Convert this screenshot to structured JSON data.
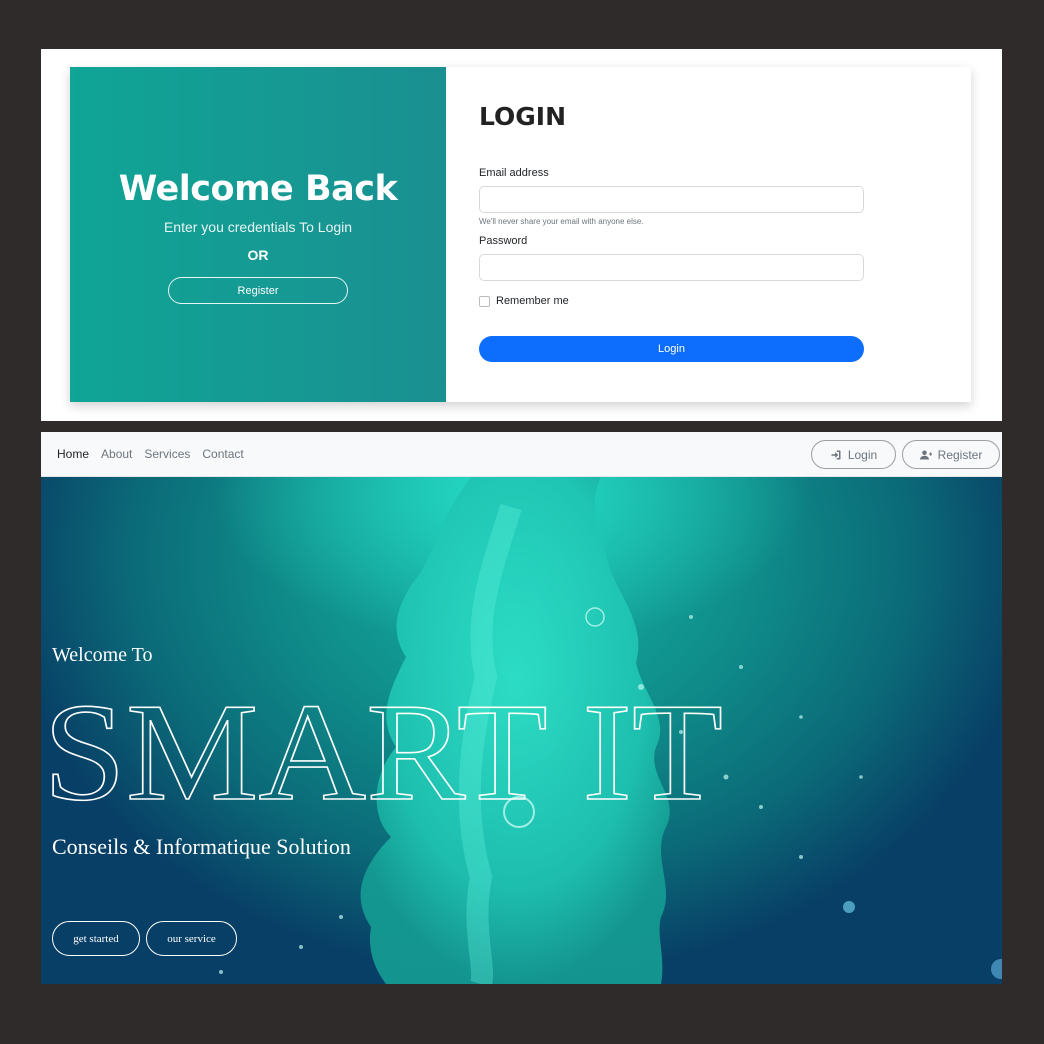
{
  "login_panel": {
    "welcome_title": "Welcome Back",
    "welcome_subtitle": "Enter you credentials To Login",
    "or_text": "OR",
    "register_button": "Register",
    "form_title": "LOGIN",
    "email_label": "Email address",
    "email_value": "",
    "email_hint": "We'll never share your email with anyone else.",
    "password_label": "Password",
    "password_value": "",
    "remember_label": "Remember me",
    "remember_checked": false,
    "login_button": "Login",
    "colors": {
      "accent_green": "#10a596",
      "primary_blue": "#0d6efd"
    }
  },
  "hero_panel": {
    "nav": {
      "links": [
        "Home",
        "About",
        "Services",
        "Contact"
      ],
      "active": "Home",
      "login_button": "Login",
      "register_button": "Register",
      "login_icon": "sign-in-icon",
      "register_icon": "user-plus-icon"
    },
    "welcome_text": "Welcome To",
    "brand": "SMART IT",
    "tagline": "Conseils & Informatique Solution",
    "get_started_button": "get started",
    "our_service_button": "our service",
    "colors": {
      "teal": "#17b3a6",
      "deep_blue": "#083f66"
    }
  }
}
